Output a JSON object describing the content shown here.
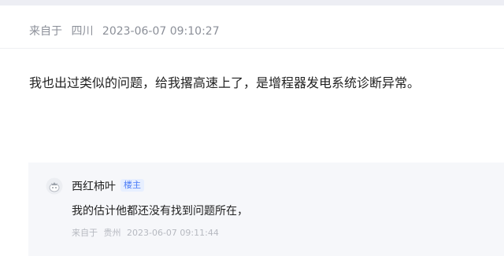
{
  "post": {
    "source_label": "来自于",
    "location": "四川",
    "timestamp": "2023-06-07 09:10:27",
    "body": "我也出过类似的问题，给我撂高速上了，是增程器发电系统诊断异常。"
  },
  "reply": {
    "author": "西红柿叶",
    "badge": "楼主",
    "text": "我的估计他都还没有找到问题所在，",
    "source_label": "来自于",
    "location": "贵州",
    "timestamp": "2023-06-07 09:11:44",
    "avatar_icon": "tomato-avatar-icon"
  },
  "colors": {
    "accent": "#4a7cf7",
    "reply_background": "#f6f7fa"
  }
}
